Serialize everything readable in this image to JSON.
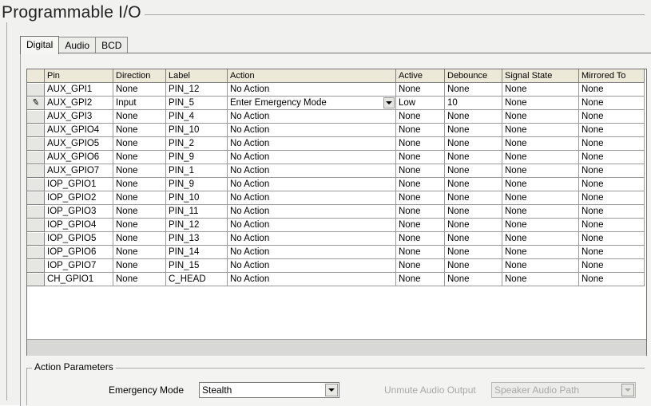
{
  "group": {
    "title": "Programmable I/O"
  },
  "tabs": [
    {
      "label": "Digital",
      "active": true
    },
    {
      "label": "Audio",
      "active": false
    },
    {
      "label": "BCD",
      "active": false
    }
  ],
  "table": {
    "columns": [
      "Pin",
      "Direction",
      "Label",
      "Action",
      "Active",
      "Debounce",
      "Signal State",
      "Mirrored To"
    ],
    "rows": [
      [
        "AUX_GPI1",
        "None",
        "PIN_12",
        "No Action",
        "None",
        "None",
        "None",
        "None"
      ],
      [
        "AUX_GPI2",
        "Input",
        "PIN_5",
        "Enter Emergency Mode",
        "Low",
        "10",
        "None",
        "None"
      ],
      [
        "AUX_GPI3",
        "None",
        "PIN_4",
        "No Action",
        "None",
        "None",
        "None",
        "None"
      ],
      [
        "AUX_GPIO4",
        "None",
        "PIN_10",
        "No Action",
        "None",
        "None",
        "None",
        "None"
      ],
      [
        "AUX_GPIO5",
        "None",
        "PIN_2",
        "No Action",
        "None",
        "None",
        "None",
        "None"
      ],
      [
        "AUX_GPIO6",
        "None",
        "PIN_9",
        "No Action",
        "None",
        "None",
        "None",
        "None"
      ],
      [
        "AUX_GPIO7",
        "None",
        "PIN_1",
        "No Action",
        "None",
        "None",
        "None",
        "None"
      ],
      [
        "IOP_GPIO1",
        "None",
        "PIN_9",
        "No Action",
        "None",
        "None",
        "None",
        "None"
      ],
      [
        "IOP_GPIO2",
        "None",
        "PIN_10",
        "No Action",
        "None",
        "None",
        "None",
        "None"
      ],
      [
        "IOP_GPIO3",
        "None",
        "PIN_11",
        "No Action",
        "None",
        "None",
        "None",
        "None"
      ],
      [
        "IOP_GPIO4",
        "None",
        "PIN_12",
        "No Action",
        "None",
        "None",
        "None",
        "None"
      ],
      [
        "IOP_GPIO5",
        "None",
        "PIN_13",
        "No Action",
        "None",
        "None",
        "None",
        "None"
      ],
      [
        "IOP_GPIO6",
        "None",
        "PIN_14",
        "No Action",
        "None",
        "None",
        "None",
        "None"
      ],
      [
        "IOP_GPIO7",
        "None",
        "PIN_15",
        "No Action",
        "None",
        "None",
        "None",
        "None"
      ],
      [
        "CH_GPIO1",
        "None",
        "C_HEAD",
        "No Action",
        "None",
        "None",
        "None",
        "None"
      ]
    ],
    "editing_row_icon": "pencil-icon"
  },
  "action_params": {
    "title": "Action Parameters",
    "emergency_mode_label": "Emergency Mode",
    "emergency_mode_value": "Stealth",
    "unmute_label": "Unmute Audio Output",
    "unmute_value": "Speaker Audio Path"
  }
}
